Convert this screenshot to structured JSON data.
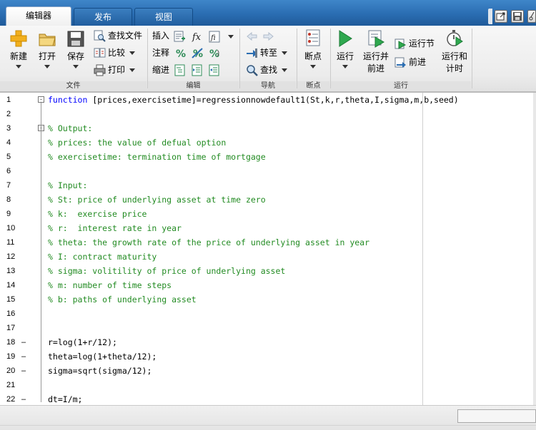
{
  "tabs": [
    {
      "label": "编辑器",
      "active": true
    },
    {
      "label": "发布",
      "active": false
    },
    {
      "label": "视图",
      "active": false
    }
  ],
  "ribbon": {
    "file": {
      "new_label": "新建",
      "open_label": "打开",
      "save_label": "保存",
      "find_files_label": "查找文件",
      "compare_label": "比较",
      "print_label": "打印",
      "group_label": "文件"
    },
    "edit": {
      "insert_label": "插入",
      "comment_label": "注释",
      "indent_label": "缩进",
      "group_label": "编辑"
    },
    "navigate": {
      "goto_label": "转至",
      "find_label": "查找",
      "group_label": "导航"
    },
    "breakpoints": {
      "breakpoints_label": "断点",
      "group_label": "断点"
    },
    "run": {
      "run_label": "运行",
      "run_advance_label_1": "运行并",
      "run_advance_label_2": "前进",
      "run_section_label": "运行节",
      "advance_label": "前进",
      "run_time_label_1": "运行和",
      "run_time_label_2": "计时",
      "group_label": "运行"
    }
  },
  "code_lines": [
    {
      "n": "1",
      "mark": "",
      "fold": "-",
      "segments": [
        {
          "cls": "kw",
          "t": "function"
        },
        {
          "cls": "",
          "t": " [prices,exercisetime]=regressionnowdefault1(St,k,r,theta,I,sigma,m,b,seed)"
        }
      ]
    },
    {
      "n": "2",
      "mark": "",
      "fold": "",
      "segments": []
    },
    {
      "n": "3",
      "mark": "",
      "fold": "-",
      "segments": [
        {
          "cls": "cm",
          "t": "% Output:"
        }
      ]
    },
    {
      "n": "4",
      "mark": "",
      "fold": "",
      "segments": [
        {
          "cls": "cm",
          "t": "% prices: the value of defual option"
        }
      ]
    },
    {
      "n": "5",
      "mark": "",
      "fold": "",
      "segments": [
        {
          "cls": "cm",
          "t": "% exercisetime: termination time of mortgage"
        }
      ]
    },
    {
      "n": "6",
      "mark": "",
      "fold": "",
      "segments": []
    },
    {
      "n": "7",
      "mark": "",
      "fold": "",
      "segments": [
        {
          "cls": "cm",
          "t": "% Input:"
        }
      ]
    },
    {
      "n": "8",
      "mark": "",
      "fold": "",
      "segments": [
        {
          "cls": "cm",
          "t": "% St: price of underlying asset at time zero"
        }
      ]
    },
    {
      "n": "9",
      "mark": "",
      "fold": "",
      "segments": [
        {
          "cls": "cm",
          "t": "% k:  exercise price"
        }
      ]
    },
    {
      "n": "10",
      "mark": "",
      "fold": "",
      "segments": [
        {
          "cls": "cm",
          "t": "% r:  interest rate in year"
        }
      ]
    },
    {
      "n": "11",
      "mark": "",
      "fold": "",
      "segments": [
        {
          "cls": "cm",
          "t": "% theta: the growth rate of the price of underlying asset in year"
        }
      ]
    },
    {
      "n": "12",
      "mark": "",
      "fold": "",
      "segments": [
        {
          "cls": "cm",
          "t": "% I: contract maturity"
        }
      ]
    },
    {
      "n": "13",
      "mark": "",
      "fold": "",
      "segments": [
        {
          "cls": "cm",
          "t": "% sigma: volitility of price of underlying asset"
        }
      ]
    },
    {
      "n": "14",
      "mark": "",
      "fold": "",
      "segments": [
        {
          "cls": "cm",
          "t": "% m: number of time steps"
        }
      ]
    },
    {
      "n": "15",
      "mark": "",
      "fold": "",
      "segments": [
        {
          "cls": "cm",
          "t": "% b: paths of underlying asset"
        }
      ]
    },
    {
      "n": "16",
      "mark": "",
      "fold": "",
      "segments": []
    },
    {
      "n": "17",
      "mark": "",
      "fold": "",
      "segments": []
    },
    {
      "n": "18",
      "mark": "–",
      "fold": "",
      "segments": [
        {
          "cls": "",
          "t": "r=log(1+r/12);"
        }
      ]
    },
    {
      "n": "19",
      "mark": "–",
      "fold": "",
      "segments": [
        {
          "cls": "",
          "t": "theta=log(1+theta/12);"
        }
      ]
    },
    {
      "n": "20",
      "mark": "–",
      "fold": "",
      "segments": [
        {
          "cls": "",
          "t": "sigma=sqrt(sigma/12);"
        }
      ]
    },
    {
      "n": "21",
      "mark": "",
      "fold": "",
      "segments": []
    },
    {
      "n": "22",
      "mark": "–",
      "fold": "",
      "segments": [
        {
          "cls": "",
          "t": "dt=I/m;"
        }
      ]
    }
  ]
}
